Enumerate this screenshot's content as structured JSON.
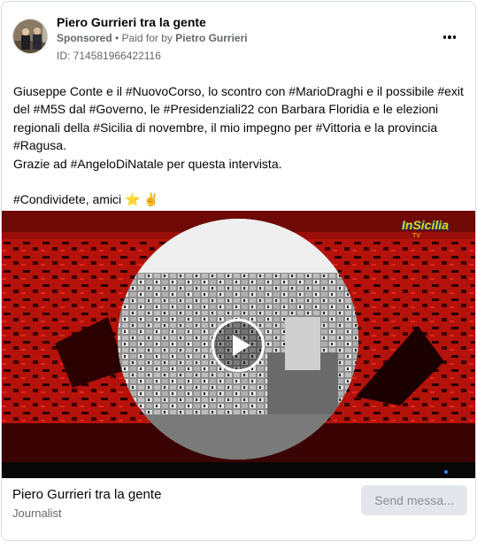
{
  "header": {
    "page_name": "Piero Gurrieri tra la gente",
    "sponsored_label": "Sponsored",
    "separator": " • ",
    "paid_prefix": "Paid for by ",
    "payer": "Pietro Gurrieri",
    "id_text": "ID: 714581966422116",
    "more_icon": "more-horizontal-icon"
  },
  "post": {
    "line1": "Giuseppe Conte e il #NuovoCorso, lo scontro con #MarioDraghi e il possibile #exit",
    "line2": "del #M5S dal #Governo, le #Presidenziali22 con Barbara Floridia e le elezioni",
    "line3": "regionali della #Sicilia di novembre, il mio impegno per #Vittoria e la provincia",
    "line4": "#Ragusa.",
    "line5": "Grazie ad #AngeloDiNatale per questa intervista.",
    "line6": "#Condividete, amici",
    "emoji_star": "⭐",
    "emoji_hand": "✌"
  },
  "video": {
    "channel_logo": "InSicilia",
    "channel_sub": "TV",
    "play_icon": "play-icon"
  },
  "footer": {
    "page_name": "Piero Gurrieri tra la gente",
    "category": "Journalist",
    "cta_label": "Send messa..."
  },
  "colors": {
    "text_primary": "#050505",
    "text_secondary": "#65676b",
    "button_bg": "#e4e6eb",
    "video_red": "#c3150e"
  }
}
